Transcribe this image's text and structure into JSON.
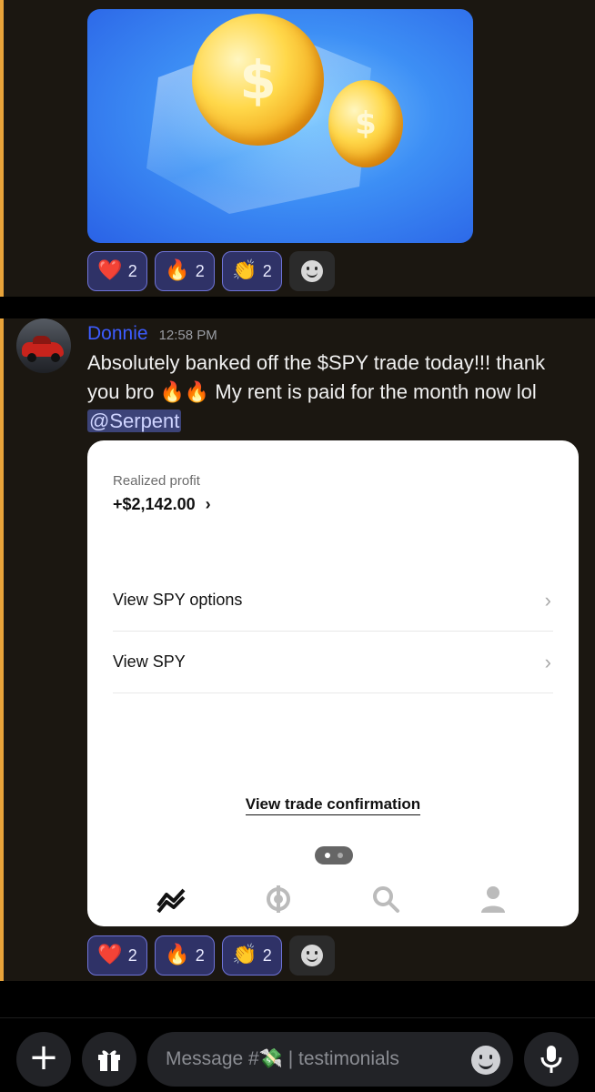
{
  "message_1": {
    "image": {
      "coin_symbol": "$"
    },
    "reactions": [
      {
        "emoji": "❤️",
        "count": "2"
      },
      {
        "emoji": "🔥",
        "count": "2"
      },
      {
        "emoji": "👏",
        "count": "2"
      }
    ]
  },
  "message_2": {
    "author": "Donnie",
    "timestamp": "12:58 PM",
    "text": "Absolutely banked off the $SPY trade today!!! thank you bro 🔥🔥 My rent is paid for the month now lol",
    "mention": "@Serpent",
    "attachment": {
      "realized_label": "Realized profit",
      "realized_value": "+$2,142.00",
      "realized_chevron": "›",
      "rows": [
        {
          "label": "View SPY options",
          "chevron": "›"
        },
        {
          "label": "View SPY",
          "chevron": "›"
        }
      ],
      "confirmation_link": "View trade confirmation"
    },
    "reactions": [
      {
        "emoji": "❤️",
        "count": "2"
      },
      {
        "emoji": "🔥",
        "count": "2"
      },
      {
        "emoji": "👏",
        "count": "2"
      }
    ]
  },
  "composer": {
    "placeholder": "Message #💸 | testimonials",
    "plus_icon": "+",
    "gift_icon": "gift-icon",
    "mic_icon": "microphone-icon"
  },
  "colors": {
    "author": "#3d5cff",
    "accent_bar": "#e8a33a",
    "reaction_bg": "#2f3267",
    "mention_bg": "#3c4378"
  }
}
